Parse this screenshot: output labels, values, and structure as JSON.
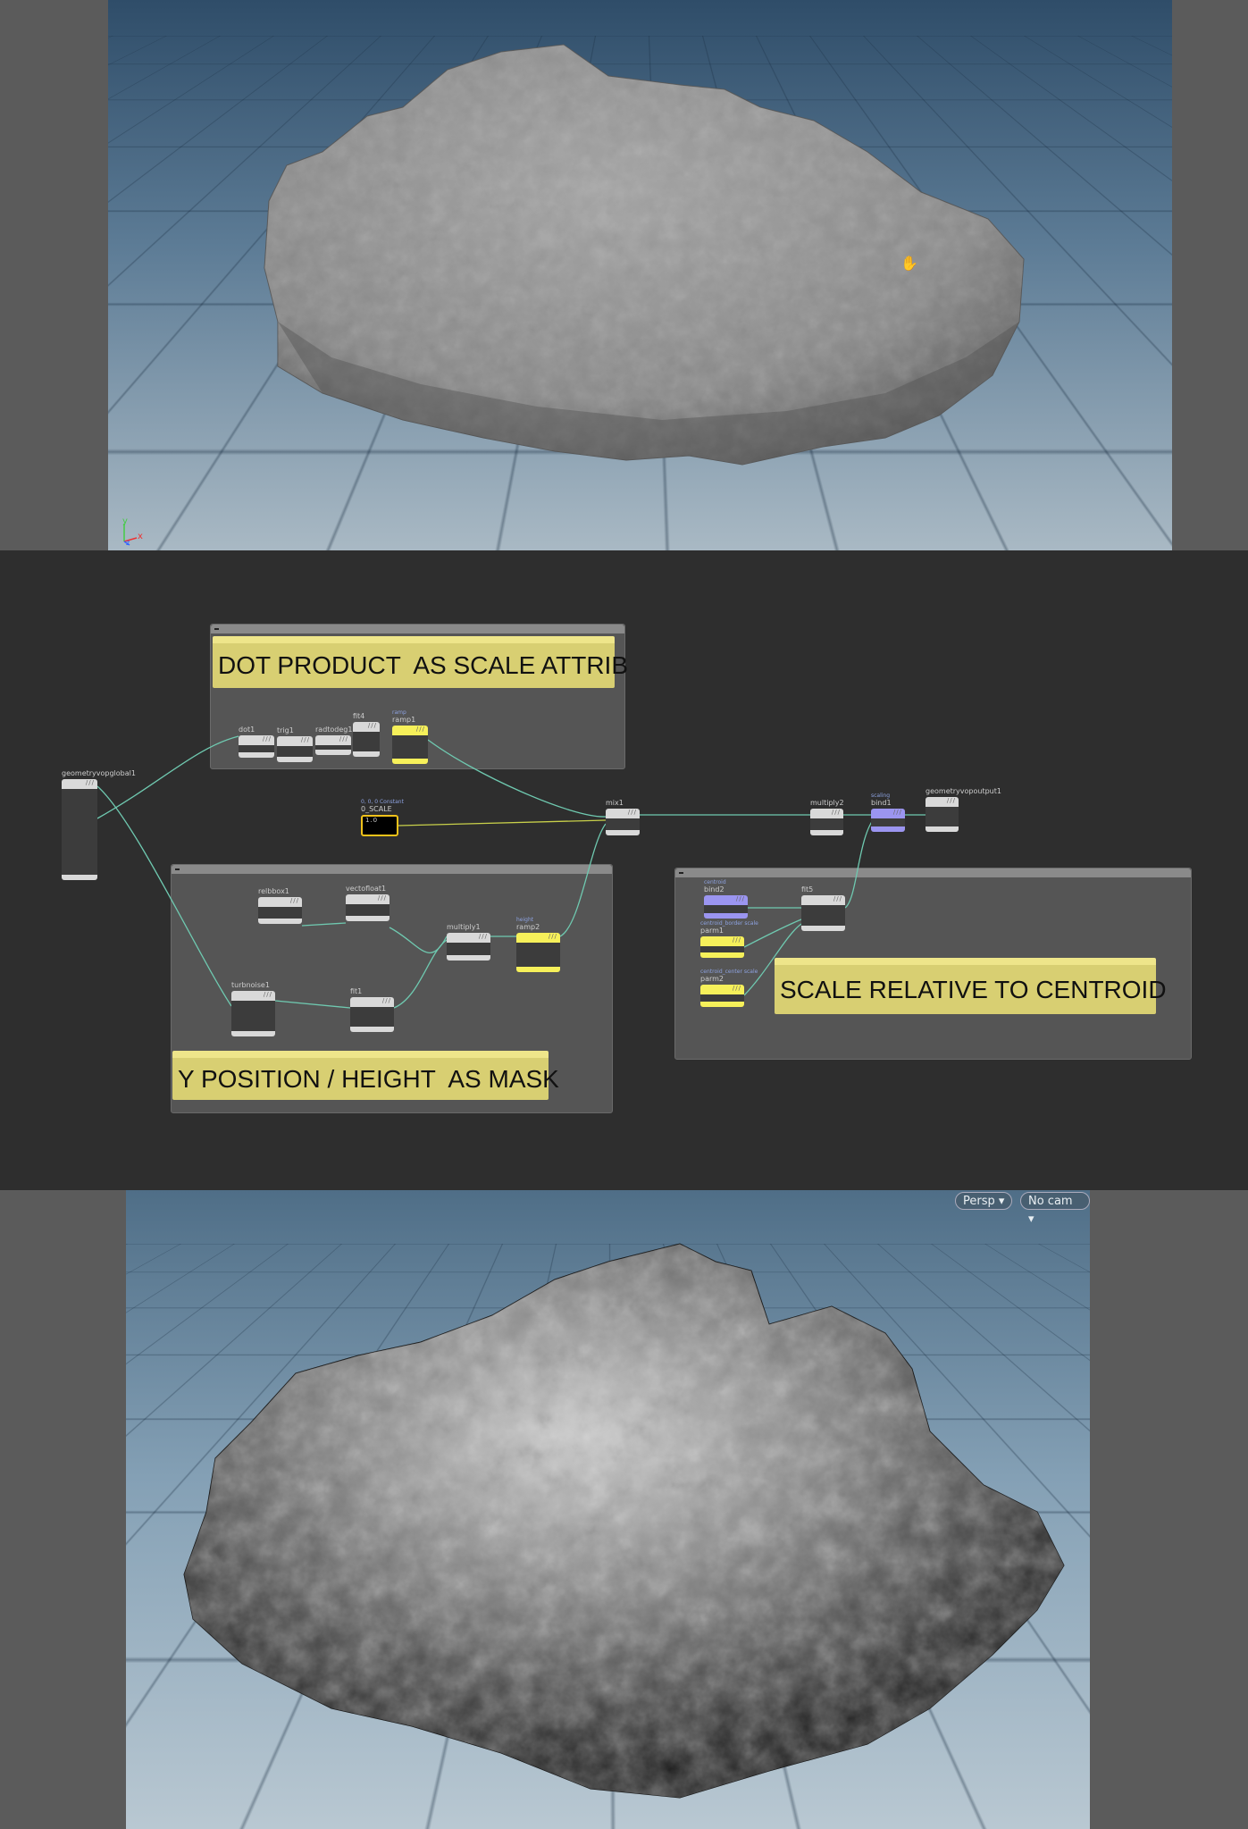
{
  "top_viewport": {
    "axes": {
      "y": "y",
      "x": "x",
      "z": "z"
    },
    "cursor": "hand-cursor"
  },
  "network": {
    "sticky_notes": [
      "DOT PRODUCT  AS SCALE ATTRIB",
      "Y POSITION / HEIGHT  AS MASK",
      "SCALE RELATIVE TO CENTROID"
    ],
    "nodes": [
      {
        "name": "geometryvopglobal1",
        "sub": "",
        "kind": "default"
      },
      {
        "name": "dot1",
        "sub": "",
        "kind": "default"
      },
      {
        "name": "trig1",
        "sub": "",
        "kind": "default"
      },
      {
        "name": "radtodeg1",
        "sub": "",
        "kind": "default"
      },
      {
        "name": "fit4",
        "sub": "",
        "kind": "default"
      },
      {
        "name": "ramp1",
        "sub": "ramp",
        "kind": "yellow"
      },
      {
        "name": "0_SCALE",
        "sub": "0, 0, 0  Constant",
        "kind": "constant",
        "value": "1.0"
      },
      {
        "name": "mix1",
        "sub": "",
        "kind": "default"
      },
      {
        "name": "multiply2",
        "sub": "",
        "kind": "default"
      },
      {
        "name": "bind1",
        "sub": "scaling",
        "kind": "purple"
      },
      {
        "name": "geometryvopoutput1",
        "sub": "",
        "kind": "default"
      },
      {
        "name": "relbbox1",
        "sub": "",
        "kind": "default"
      },
      {
        "name": "vectofloat1",
        "sub": "",
        "kind": "default"
      },
      {
        "name": "multiply1",
        "sub": "",
        "kind": "default"
      },
      {
        "name": "ramp2",
        "sub": "height",
        "kind": "yellow"
      },
      {
        "name": "turbnoise1",
        "sub": "",
        "kind": "default"
      },
      {
        "name": "fit1",
        "sub": "",
        "kind": "default"
      },
      {
        "name": "bind2",
        "sub": "centroid",
        "kind": "purple"
      },
      {
        "name": "fit5",
        "sub": "",
        "kind": "default"
      },
      {
        "name": "parm1",
        "sub": "centroid_border scale",
        "kind": "yellow"
      },
      {
        "name": "parm2",
        "sub": "centroid_center scale",
        "kind": "yellow"
      }
    ]
  },
  "bottom_viewport": {
    "view_button": "Persp ▾",
    "camera_button": "No cam ▾"
  },
  "colors": {
    "wire": "#6fc9b0",
    "sticky": "#d8cf72",
    "node_yellow": "#f6f05a",
    "node_purple": "#9b95f0"
  }
}
